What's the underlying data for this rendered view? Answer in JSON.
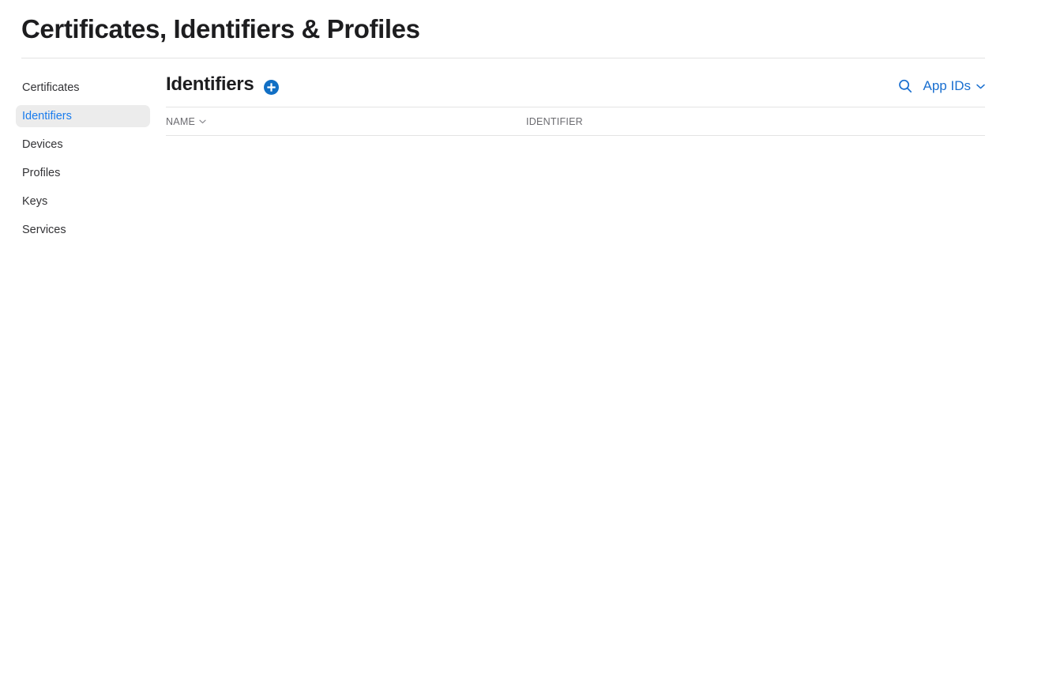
{
  "page": {
    "title": "Certificates, Identifiers & Profiles"
  },
  "sidebar": {
    "items": [
      {
        "label": "Certificates",
        "selected": false
      },
      {
        "label": "Identifiers",
        "selected": true
      },
      {
        "label": "Devices",
        "selected": false
      },
      {
        "label": "Profiles",
        "selected": false
      },
      {
        "label": "Keys",
        "selected": false
      },
      {
        "label": "Services",
        "selected": false
      }
    ]
  },
  "main": {
    "heading": "Identifiers",
    "add_button_icon": "plus-icon",
    "search_icon": "search-icon",
    "filter": {
      "label": "App IDs",
      "chevron_icon": "chevron-down-icon"
    },
    "table": {
      "columns": [
        {
          "label": "NAME",
          "sort_icon": "chevron-down-icon"
        },
        {
          "label": "IDENTIFIER",
          "sort_icon": ""
        }
      ],
      "rows": []
    }
  },
  "colors": {
    "accent_blue": "#1a7ced",
    "link_blue": "#1a6fd0",
    "add_button_blue": "#116fc4",
    "selected_bg": "#ececec",
    "divider": "#e3e3e3",
    "text_primary": "#1d1d1f",
    "text_secondary": "#6b6b70"
  }
}
